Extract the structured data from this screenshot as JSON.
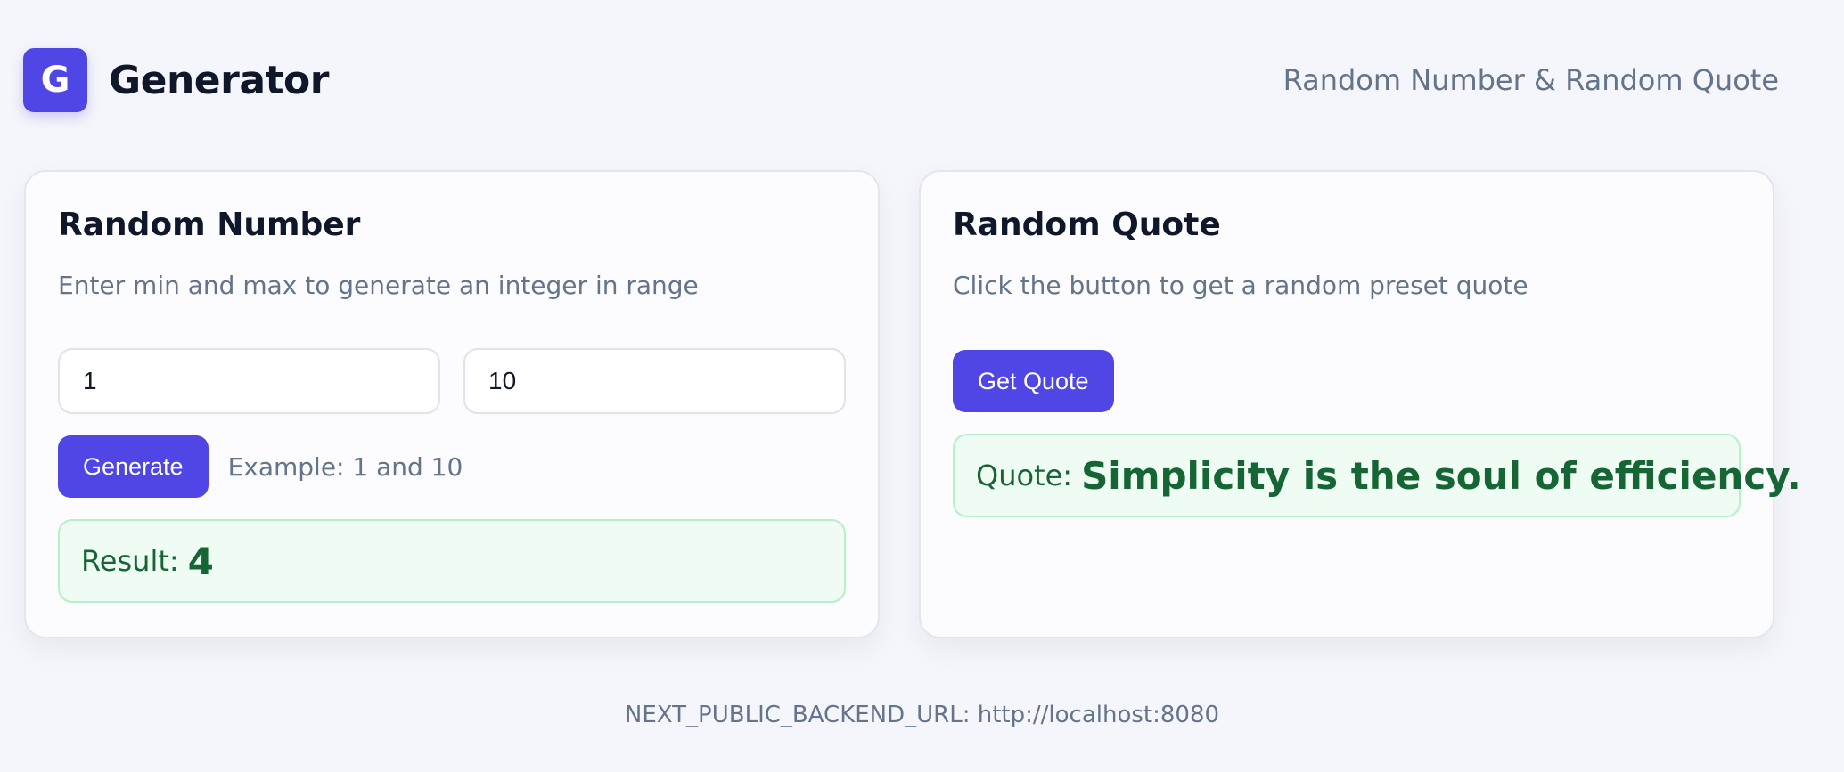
{
  "header": {
    "logo_letter": "G",
    "title": "Generator",
    "subtitle": "Random Number & Random Quote"
  },
  "random_number": {
    "title": "Random Number",
    "description": "Enter min and max to generate an integer in range",
    "min_value": "1",
    "max_value": "10",
    "generate_label": "Generate",
    "example_text": "Example: 1 and 10",
    "result_label": "Result:",
    "result_value": "4"
  },
  "random_quote": {
    "title": "Random Quote",
    "description": "Click the button to get a random preset quote",
    "button_label": "Get Quote",
    "quote_label": "Quote:",
    "quote_text": "Simplicity is the soul of efficiency."
  },
  "footer": {
    "text": "NEXT_PUBLIC_BACKEND_URL: http://localhost:8080"
  },
  "colors": {
    "accent": "#4f46e5",
    "success_text": "#166534",
    "success_bg": "#effcf3",
    "success_border": "#b7efc8",
    "muted_text": "#64748b",
    "page_bg": "#f5f6fb"
  }
}
